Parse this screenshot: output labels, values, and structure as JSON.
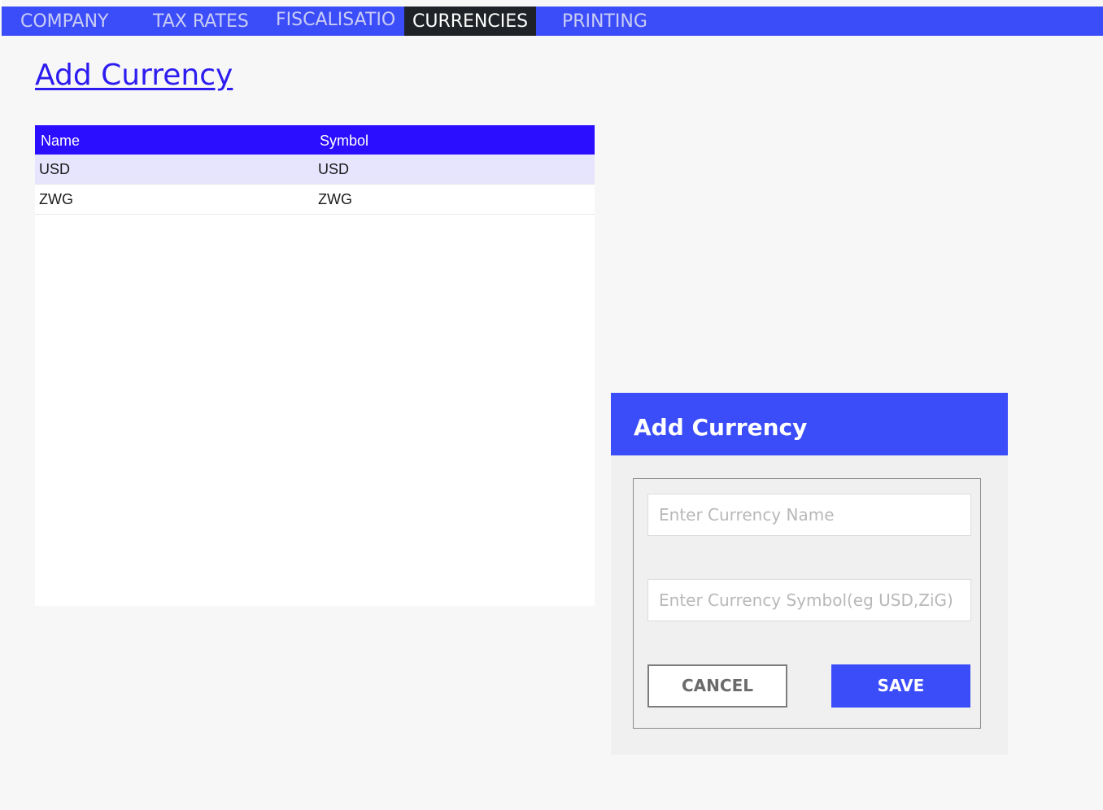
{
  "nav": {
    "tabs": [
      {
        "label": "COMPANY"
      },
      {
        "label": "TAX RATES"
      },
      {
        "label": "FISCALISATIO"
      },
      {
        "label": "CURRENCIES"
      },
      {
        "label": "PRINTING"
      }
    ],
    "active_tab": "CURRENCIES"
  },
  "page": {
    "add_link": "Add Currency"
  },
  "table": {
    "columns": [
      "Name",
      "Symbol"
    ],
    "rows": [
      {
        "name": "USD",
        "symbol": "USD"
      },
      {
        "name": "ZWG",
        "symbol": "ZWG"
      }
    ]
  },
  "dialog": {
    "title": "Add Currency",
    "name_placeholder": "Enter Currency Name",
    "symbol_placeholder": "Enter Currency Symbol(eg USD,ZiG)",
    "name_value": "",
    "symbol_value": "",
    "cancel_label": "CANCEL",
    "save_label": "SAVE"
  },
  "colors": {
    "nav_bg": "#3b4cf9",
    "active_tab_bg": "#1f2227",
    "table_header_bg": "#2b0dff",
    "row_alt_bg": "#e7e5fd",
    "link": "#2c1cf0"
  }
}
